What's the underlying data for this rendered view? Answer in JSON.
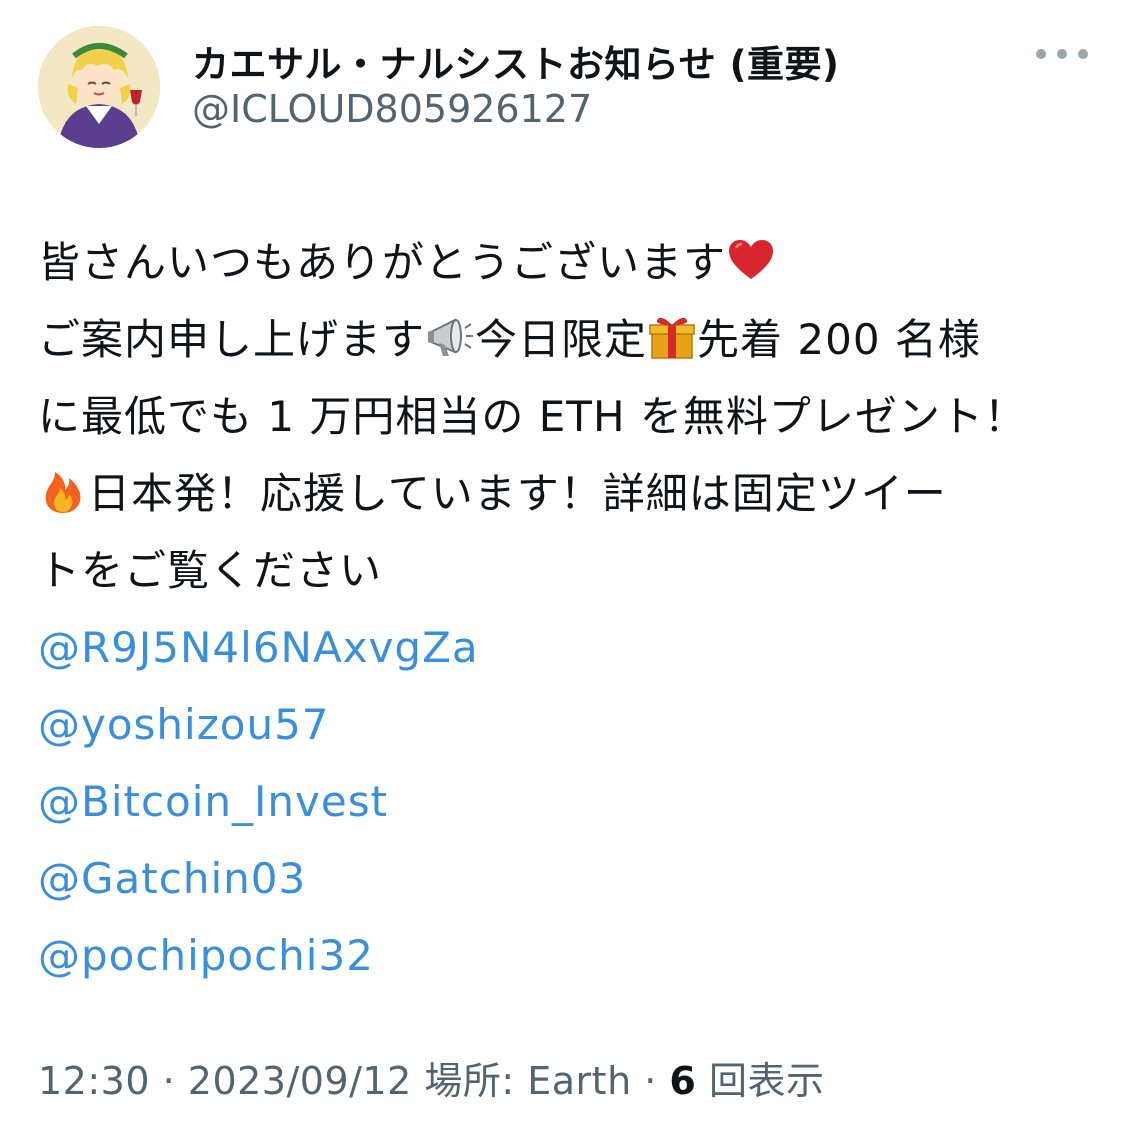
{
  "author": {
    "display_name": "カエサル・ナルシストお知らせ (重要)",
    "handle": "@ICLOUD805926127"
  },
  "tweet": {
    "line1": "皆さんいつもありがとうございます",
    "line2a": "ご案内申し上げます",
    "line2b": "今日限定",
    "line2c": "先着 200 名様",
    "line3": "に最低でも 1 万円相当の ETH を無料プレゼント！",
    "line4": "日本発！応援しています！詳細は固定ツイー",
    "line5": "トをご覧ください",
    "mentions": [
      "@R9J5N4l6NAxvgZa",
      "@yoshizou57",
      "@Bitcoin_Invest",
      "@Gatchin03",
      "@pochipochi32"
    ]
  },
  "meta": {
    "time": "12:30",
    "sep1": " · ",
    "date": "2023/09/12",
    "location": " 場所: Earth",
    "sep2": " · ",
    "views_count": "6",
    "views_label": " 回表示"
  },
  "icons": {
    "heart": "red-heart-icon",
    "megaphone": "megaphone-icon",
    "gift": "gift-icon",
    "fire": "fire-icon",
    "more": "more-options-icon"
  },
  "colors": {
    "link": "#3a8fdd",
    "secondary_text": "#536471",
    "primary_text": "#0f1419"
  }
}
